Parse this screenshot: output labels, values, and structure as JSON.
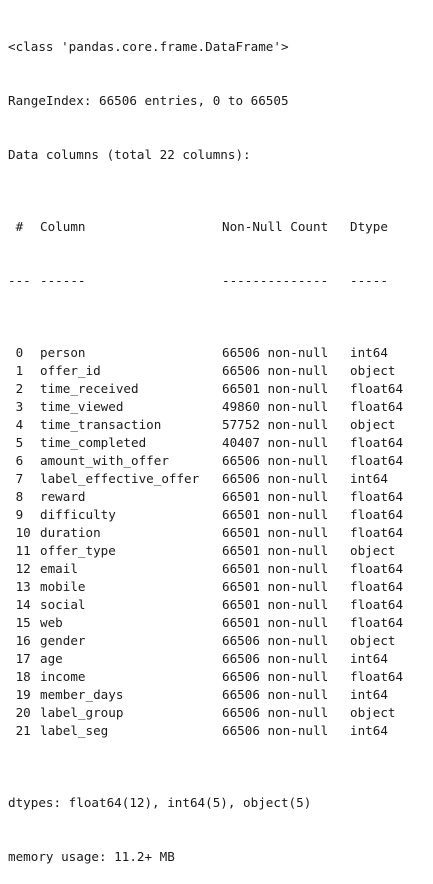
{
  "header": {
    "class_line": "<class 'pandas.core.frame.DataFrame'>",
    "range_index": "RangeIndex: 66506 entries, 0 to 66505",
    "data_columns": "Data columns (total 22 columns):"
  },
  "table": {
    "headers": {
      "idx": " #",
      "column": "Column",
      "count": "Non-Null Count",
      "dtype": "Dtype"
    },
    "separators": {
      "idx": "---",
      "column": "------",
      "count": "--------------",
      "dtype": "-----"
    },
    "rows": [
      {
        "idx": " 0",
        "column": "person",
        "count": "66506 non-null",
        "dtype": "int64"
      },
      {
        "idx": " 1",
        "column": "offer_id",
        "count": "66506 non-null",
        "dtype": "object"
      },
      {
        "idx": " 2",
        "column": "time_received",
        "count": "66501 non-null",
        "dtype": "float64"
      },
      {
        "idx": " 3",
        "column": "time_viewed",
        "count": "49860 non-null",
        "dtype": "float64"
      },
      {
        "idx": " 4",
        "column": "time_transaction",
        "count": "57752 non-null",
        "dtype": "object"
      },
      {
        "idx": " 5",
        "column": "time_completed",
        "count": "40407 non-null",
        "dtype": "float64"
      },
      {
        "idx": " 6",
        "column": "amount_with_offer",
        "count": "66506 non-null",
        "dtype": "float64"
      },
      {
        "idx": " 7",
        "column": "label_effective_offer",
        "count": "66506 non-null",
        "dtype": "int64"
      },
      {
        "idx": " 8",
        "column": "reward",
        "count": "66501 non-null",
        "dtype": "float64"
      },
      {
        "idx": " 9",
        "column": "difficulty",
        "count": "66501 non-null",
        "dtype": "float64"
      },
      {
        "idx": " 10",
        "column": "duration",
        "count": "66501 non-null",
        "dtype": "float64"
      },
      {
        "idx": " 11",
        "column": "offer_type",
        "count": "66501 non-null",
        "dtype": "object"
      },
      {
        "idx": " 12",
        "column": "email",
        "count": "66501 non-null",
        "dtype": "float64"
      },
      {
        "idx": " 13",
        "column": "mobile",
        "count": "66501 non-null",
        "dtype": "float64"
      },
      {
        "idx": " 14",
        "column": "social",
        "count": "66501 non-null",
        "dtype": "float64"
      },
      {
        "idx": " 15",
        "column": "web",
        "count": "66501 non-null",
        "dtype": "float64"
      },
      {
        "idx": " 16",
        "column": "gender",
        "count": "66506 non-null",
        "dtype": "object"
      },
      {
        "idx": " 17",
        "column": "age",
        "count": "66506 non-null",
        "dtype": "int64"
      },
      {
        "idx": " 18",
        "column": "income",
        "count": "66506 non-null",
        "dtype": "float64"
      },
      {
        "idx": " 19",
        "column": "member_days",
        "count": "66506 non-null",
        "dtype": "int64"
      },
      {
        "idx": " 20",
        "column": "label_group",
        "count": "66506 non-null",
        "dtype": "object"
      },
      {
        "idx": " 21",
        "column": "label_seg",
        "count": "66506 non-null",
        "dtype": "int64"
      }
    ]
  },
  "footer": {
    "dtypes": "dtypes: float64(12), int64(5), object(5)",
    "memory": "memory usage: 11.2+ MB"
  }
}
